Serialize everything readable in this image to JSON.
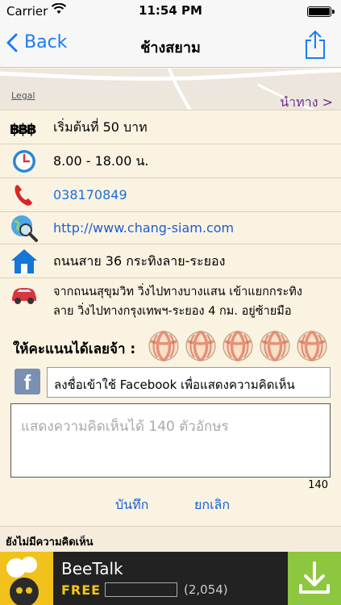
{
  "status_bar": {
    "carrier": "Carrier",
    "time": "11:54 PM"
  },
  "nav": {
    "back_label": "Back",
    "title": "ช้างสยาม"
  },
  "map": {
    "legal": "Legal",
    "navigate_label": "นำทาง >"
  },
  "details": {
    "price": "เริ่มต้นที่ 50 บาท",
    "hours": "8.00 - 18.00 น.",
    "phone": "038170849",
    "website": "http://www.chang-siam.com",
    "address": "ถนนสาย 36 กระทิงลาย-ระยอง",
    "directions_line1": "จากถนนสุขุมวิท วิ่งไปทางบางแสน เข้าแยกกระทิง",
    "directions_line2": "ลาย วิ่งไปทางกรุงเทพฯ-ระยอง 4 กม. อยู่ซ้ายมือ"
  },
  "rating": {
    "label": "ให้คะแนนได้เลยจ้า :",
    "max": 5,
    "value": 0
  },
  "facebook": {
    "icon_letter": "f",
    "login_label": "ลงชื่อเข้าใช้ Facebook เพื่อแสดงความคิดเห็น"
  },
  "comment": {
    "placeholder": "แสดงความคิดเห็นได้ 140 ตัวอักษร",
    "remaining": "140"
  },
  "actions": {
    "save_label": "บันทึก",
    "cancel_label": "ยกเลิก"
  },
  "comments_status": "ยังไม่มีความคิดเห็น",
  "ad": {
    "app_name": "BeeTalk",
    "price": "FREE",
    "rating_count": "(2,054)"
  },
  "colors": {
    "accent": "#1a7cf6",
    "navigate": "#6e2c8a",
    "background": "#fbf3e2",
    "ad_download": "#8dc63f"
  },
  "icons": {
    "price": "baht-icon",
    "hours": "clock-icon",
    "phone": "phone-icon",
    "website": "globe-search-icon",
    "address": "home-icon",
    "directions": "car-icon",
    "rating": "beach-ball-icon",
    "share": "share-icon",
    "back": "chevron-left-icon"
  }
}
